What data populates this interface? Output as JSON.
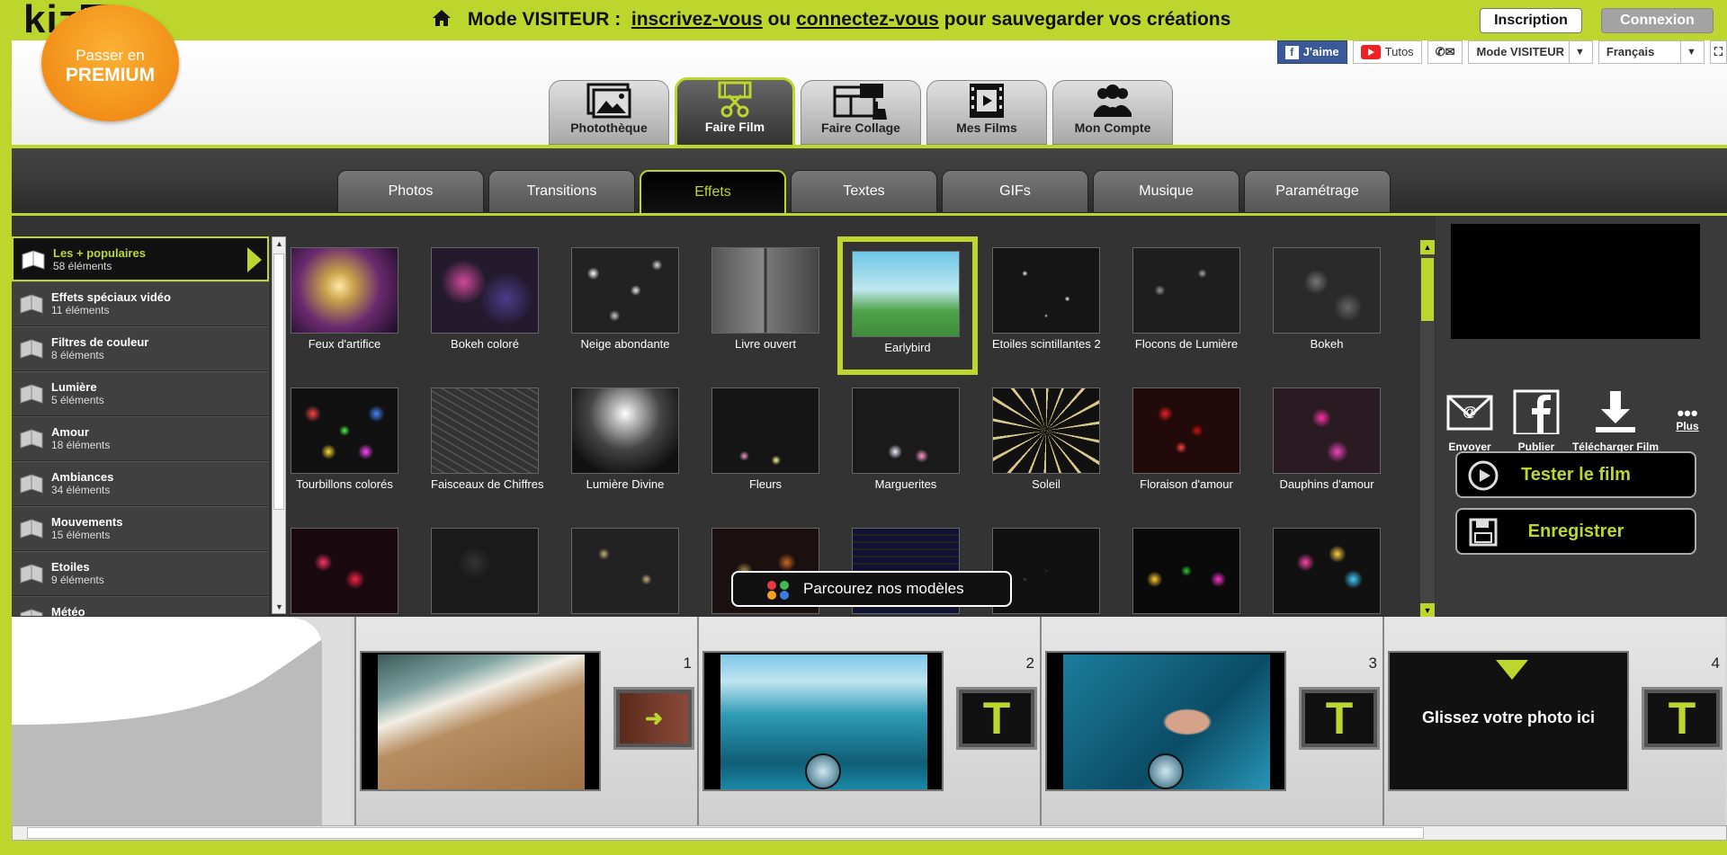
{
  "topbar": {
    "logo": "kizoa",
    "mode_label": "Mode VISITEUR :",
    "link_register": "inscrivez-vous",
    "word_or": "ou",
    "link_connect": "connectez-vous",
    "msg_tail": "pour sauvegarder vos créations",
    "btn_inscription": "Inscription",
    "btn_connexion": "Connexion",
    "accent": "#bcd62e"
  },
  "premium": {
    "line1": "Passer en",
    "line2": "PREMIUM"
  },
  "tools": {
    "like": "J'aime",
    "tutos": "Tutos",
    "mode": "Mode VISITEUR",
    "lang": "Français"
  },
  "main_tabs": [
    {
      "label": "Photothèque",
      "icon": "photo-library-icon"
    },
    {
      "label": "Faire Film",
      "icon": "film-scissors-icon",
      "active": true
    },
    {
      "label": "Faire Collage",
      "icon": "collage-icon"
    },
    {
      "label": "Mes Films",
      "icon": "film-strip-icon"
    },
    {
      "label": "Mon Compte",
      "icon": "users-icon"
    }
  ],
  "sub_tabs": [
    {
      "label": "Photos"
    },
    {
      "label": "Transitions"
    },
    {
      "label": "Effets",
      "active": true
    },
    {
      "label": "Textes"
    },
    {
      "label": "GIFs"
    },
    {
      "label": "Musique"
    },
    {
      "label": "Paramétrage"
    }
  ],
  "categories": [
    {
      "name": "Les + populaires",
      "count": "58 éléments",
      "active": true
    },
    {
      "name": "Effets spéciaux vidéo",
      "count": "11 éléments"
    },
    {
      "name": "Filtres de couleur",
      "count": "8 éléments"
    },
    {
      "name": "Lumière",
      "count": "5 éléments"
    },
    {
      "name": "Amour",
      "count": "18 éléments"
    },
    {
      "name": "Ambiances",
      "count": "34 éléments"
    },
    {
      "name": "Mouvements",
      "count": "15 éléments"
    },
    {
      "name": "Etoiles",
      "count": "9 éléments"
    },
    {
      "name": "Météo",
      "count": ""
    }
  ],
  "effects": [
    {
      "label": "Feux d'artifice"
    },
    {
      "label": "Bokeh coloré"
    },
    {
      "label": "Neige abondante"
    },
    {
      "label": "Livre ouvert"
    },
    {
      "label": "Earlybird",
      "selected": true
    },
    {
      "label": "Etoiles scintillantes 2"
    },
    {
      "label": "Flocons de Lumière"
    },
    {
      "label": "Bokeh"
    },
    {
      "label": "Tourbillons colorés"
    },
    {
      "label": "Faisceaux de Chiffres"
    },
    {
      "label": "Lumière Divine"
    },
    {
      "label": "Fleurs"
    },
    {
      "label": "Marguerites"
    },
    {
      "label": "Soleil"
    },
    {
      "label": "Floraison d'amour"
    },
    {
      "label": "Dauphins d'amour"
    },
    {
      "label": ""
    },
    {
      "label": ""
    },
    {
      "label": ""
    },
    {
      "label": ""
    },
    {
      "label": ""
    },
    {
      "label": ""
    },
    {
      "label": ""
    },
    {
      "label": ""
    }
  ],
  "browse_models": "Parcourez nos modèles",
  "actions": {
    "send": "Envoyer",
    "publish": "Publier",
    "download": "Télécharger Film",
    "more": "Plus"
  },
  "btn_test": "Tester le film",
  "btn_save": "Enregistrer",
  "timeline": {
    "slots": [
      {
        "num": "1",
        "kind": "sand-beach"
      },
      {
        "num": "2",
        "kind": "sea-hand"
      },
      {
        "num": "3",
        "kind": "pool-woman"
      },
      {
        "num": "4",
        "kind": "empty"
      }
    ],
    "drop_text": "Glissez votre photo ici",
    "text_icon": "T"
  }
}
